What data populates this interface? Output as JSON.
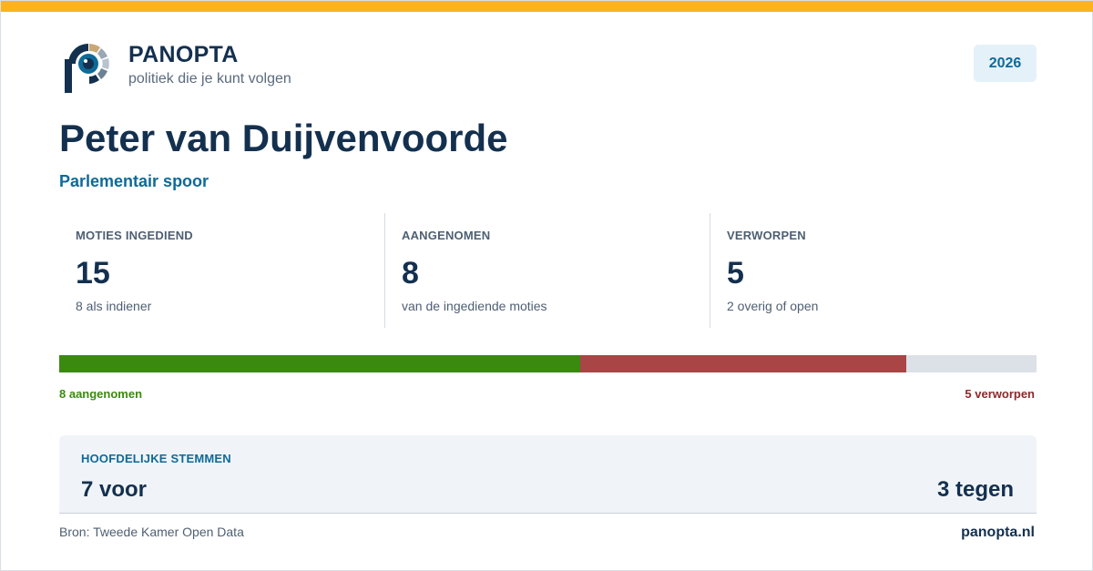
{
  "colors": {
    "accent_bar": "#fbb41e",
    "brand_navy": "#14304f",
    "brand_blue": "#0e6a98",
    "accepted_green": "#3a8a10",
    "rejected_red": "#a94545",
    "remaining_grey": "#dce1e8"
  },
  "brand": {
    "name": "PANOPTA",
    "tagline": "politiek die je kunt volgen",
    "logo_icon": "panopta-eye-logo-icon"
  },
  "year": "2026",
  "person": {
    "name": "Peter van Duijvenvoorde",
    "subtitle": "Parlementair spoor"
  },
  "stats": [
    {
      "label": "MOTIES INGEDIEND",
      "value": "15",
      "note": "8 als indiener"
    },
    {
      "label": "AANGENOMEN",
      "value": "8",
      "note": "van de ingediende moties"
    },
    {
      "label": "VERWORPEN",
      "value": "5",
      "note": "2 overig of open"
    }
  ],
  "progress": {
    "total": 15,
    "accepted": 8,
    "rejected": 5,
    "accepted_label": "8 aangenomen",
    "rejected_label": "5 verworpen"
  },
  "votes": {
    "title": "HOOFDELIJKE STEMMEN",
    "for_label": "7 voor",
    "against_label": "3 tegen"
  },
  "footer": {
    "source": "Bron: Tweede Kamer Open Data",
    "site": "panopta.nl"
  }
}
